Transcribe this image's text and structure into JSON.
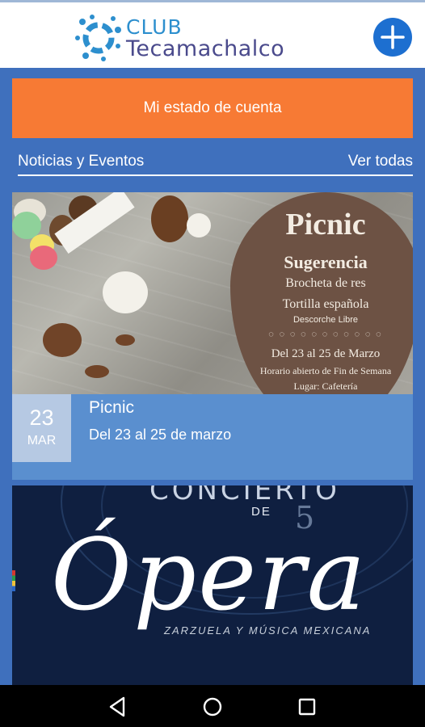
{
  "header": {
    "logo_club": "CLUB",
    "logo_name": "Tecamachalco",
    "add_icon": "plus-icon"
  },
  "account": {
    "label": "Mi estado de cuenta"
  },
  "news": {
    "title": "Noticias y Eventos",
    "link": "Ver todas"
  },
  "events": [
    {
      "day": "23",
      "month": "MAR",
      "title": "Picnic",
      "date_text": "Del 23 al 25 de marzo",
      "banner": {
        "title": "Picnic",
        "subtitle": "Sugerencia",
        "line1": "Brocheta de res",
        "line2": "Tortilla española",
        "line3": "Descorche Libre",
        "dates": "Del 23 al 25 de Marzo",
        "hours": "Horario abierto de Fin de Semana",
        "place": "Lugar: Cafetería"
      }
    },
    {
      "banner": {
        "top": "CONCIERTO",
        "de": "DE",
        "number": "5",
        "main": "Ópera",
        "sub": "ZARZUELA Y MÚSICA MEXICANA"
      }
    }
  ],
  "navbar": {
    "back_icon": "back-triangle-icon",
    "home_icon": "home-circle-icon",
    "recents_icon": "recents-square-icon"
  },
  "colors": {
    "background": "#3f70bd",
    "accent_orange": "#f77a34",
    "fab_blue": "#1d6fd0",
    "event_bar": "#5a8fcf",
    "date_box": "#b6c9e3"
  }
}
